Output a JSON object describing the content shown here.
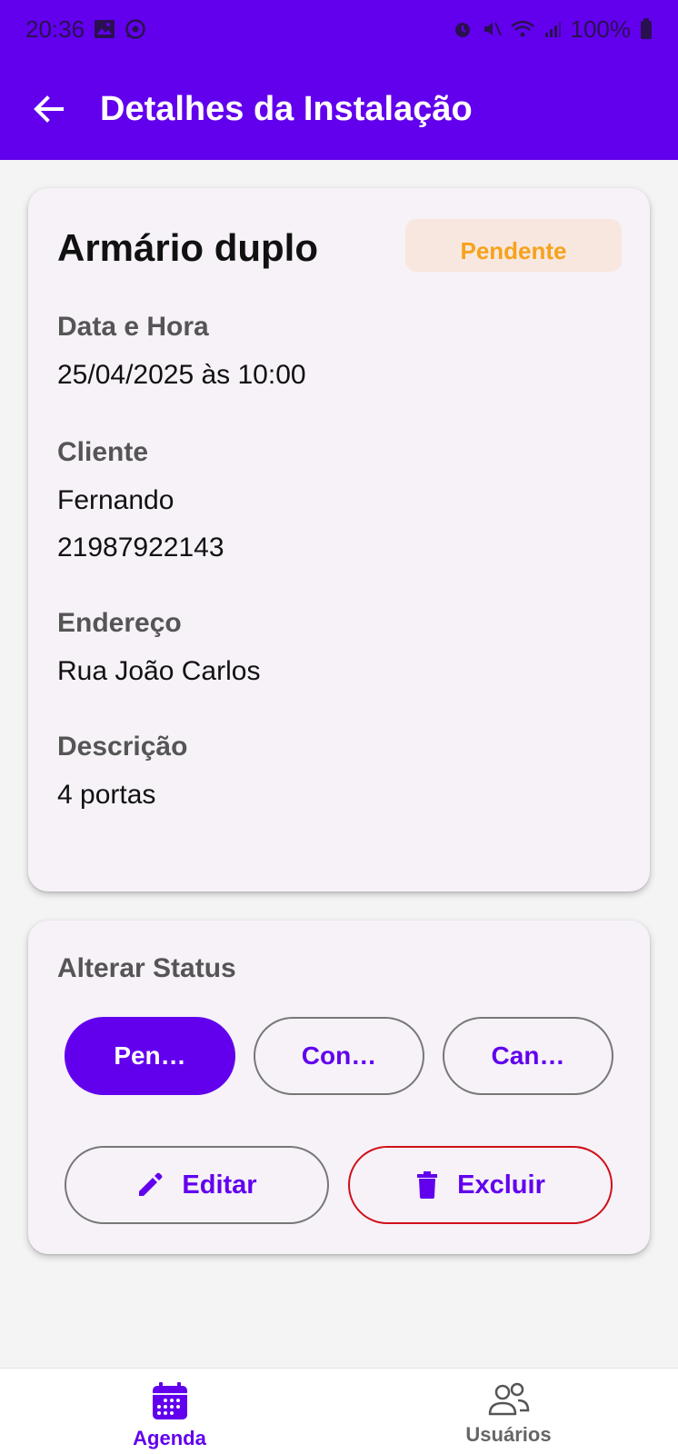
{
  "status_bar": {
    "time": "20:36",
    "battery": "100%"
  },
  "toolbar": {
    "title": "Detalhes da Instalação",
    "back_icon": "arrow-back-icon"
  },
  "installation": {
    "title": "Armário duplo",
    "status_badge": "Pendente",
    "fields": {
      "datetime": {
        "label": "Data e Hora",
        "value": "25/04/2025 às 10:00"
      },
      "client": {
        "label": "Cliente",
        "name": "Fernando",
        "phone": "21987922143"
      },
      "address": {
        "label": "Endereço",
        "value": "Rua João Carlos"
      },
      "description": {
        "label": "Descrição",
        "value": "4 portas"
      }
    }
  },
  "status_section": {
    "label": "Alterar Status",
    "options": [
      {
        "label": "Pen…",
        "selected": true
      },
      {
        "label": "Con…",
        "selected": false
      },
      {
        "label": "Can…",
        "selected": false
      }
    ],
    "edit_label": "Editar",
    "delete_label": "Excluir"
  },
  "bottom_nav": {
    "items": [
      {
        "label": "Agenda",
        "icon": "calendar-icon",
        "active": true
      },
      {
        "label": "Usuários",
        "icon": "users-icon",
        "active": false
      }
    ]
  },
  "colors": {
    "primary": "#6200ee",
    "pending_text": "#f7a21b",
    "pending_bg": "#f7e7df",
    "danger": "#d0101a"
  }
}
